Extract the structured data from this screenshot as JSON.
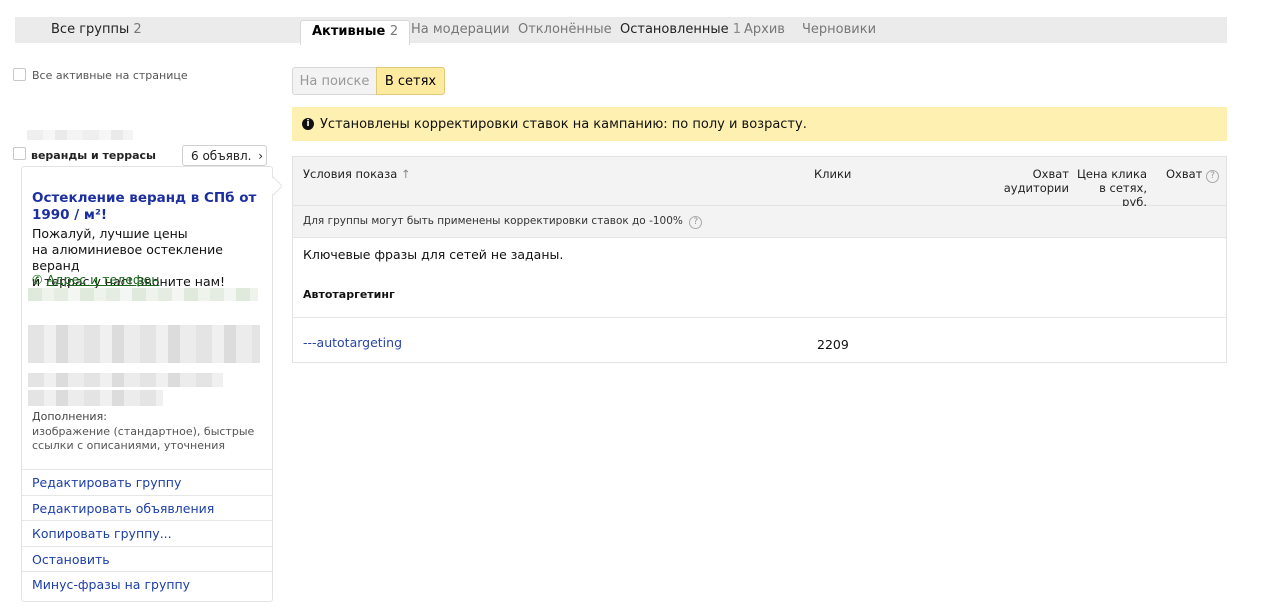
{
  "tabs": {
    "all_groups": {
      "label": "Все группы",
      "count": "2"
    },
    "active": {
      "label": "Активные",
      "count": "2"
    },
    "moderation": {
      "label": "На модерации"
    },
    "rejected": {
      "label": "Отклонённые"
    },
    "stopped": {
      "label": "Остановленные",
      "count": "1"
    },
    "archive": {
      "label": "Архив"
    },
    "drafts": {
      "label": "Черновики"
    }
  },
  "left": {
    "all_active_label": "Все активные на странице",
    "group_name": "веранды и террасы",
    "ads_count_label": "6 объявл.",
    "ad": {
      "title": "Остекление веранд в СПб от 1990 / м²!",
      "text_line1": "Пожалуй, лучшие цены",
      "text_line2": "на алюминиевое остекление веранд",
      "text_line3": "и террас у нас! Звоните нам!",
      "contact_link": "Адрес и телефон"
    },
    "addons_heading": "Дополнения:",
    "addons_text": "изображение (стандартное), быстрые ссылки с описаниями, уточнения",
    "actions": [
      "Редактировать группу",
      "Редактировать объявления",
      "Копировать группу...",
      "Остановить",
      "Минус-фразы на группу"
    ]
  },
  "segment": {
    "search": "На поиске",
    "networks": "В сетях"
  },
  "notice": "Установлены корректировки ставок на кампанию: по полу и возрасту.",
  "table": {
    "headers": {
      "conditions": "Условия показа",
      "conditions_sort": "↑",
      "clicks": "Клики",
      "audience_reach_1": "Охват",
      "audience_reach_2": "аудитории",
      "cpc_1": "Цена клика",
      "cpc_2": "в сетях, руб.",
      "reach": "Охват"
    },
    "subhead": "Для группы могут быть применены корректировки ставок до -100%",
    "no_phrases": "Ключевые фразы для сетей не заданы.",
    "autotargeting_heading": "Автотаргетинг",
    "rows": [
      {
        "condition": "---autotargeting",
        "clicks": "2209"
      }
    ]
  }
}
